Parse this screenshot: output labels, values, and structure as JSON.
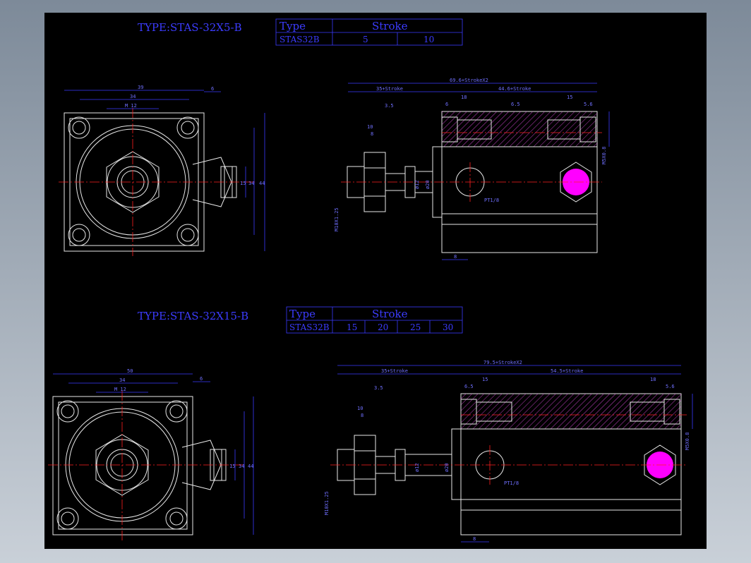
{
  "drawings": [
    {
      "title": "TYPE:STAS-32X5-B",
      "table": {
        "header_type": "Type",
        "header_stroke": "Stroke",
        "model": "STAS32B",
        "strokes": [
          "5",
          "10"
        ]
      },
      "front_dims": [
        "39",
        "34",
        "M 12",
        "6",
        "15",
        "34",
        "44"
      ],
      "side_dims": [
        "69.6+StrokeX2",
        "35+Stroke",
        "44.6+Stroke",
        "18",
        "6",
        "6.5",
        "15",
        "5.6",
        "3.5",
        "10",
        "8",
        "M10X1.25",
        "ø12",
        "ø20",
        "PT1/8",
        "8",
        "M5X0.8"
      ]
    },
    {
      "title": "TYPE:STAS-32X15-B",
      "table": {
        "header_type": "Type",
        "header_stroke": "Stroke",
        "model": "STAS32B",
        "strokes": [
          "15",
          "20",
          "25",
          "30"
        ]
      },
      "front_dims": [
        "50",
        "34",
        "M 12",
        "6",
        "15",
        "34",
        "44"
      ],
      "side_dims": [
        "79.5+StrokeX2",
        "35+Stroke",
        "54.5+Stroke",
        "15",
        "18",
        "6.5",
        "5.6",
        "3.5",
        "10",
        "8",
        "M10X1.25",
        "ø12",
        "ø20",
        "PT1/8",
        "8",
        "M5X0.8"
      ]
    }
  ]
}
